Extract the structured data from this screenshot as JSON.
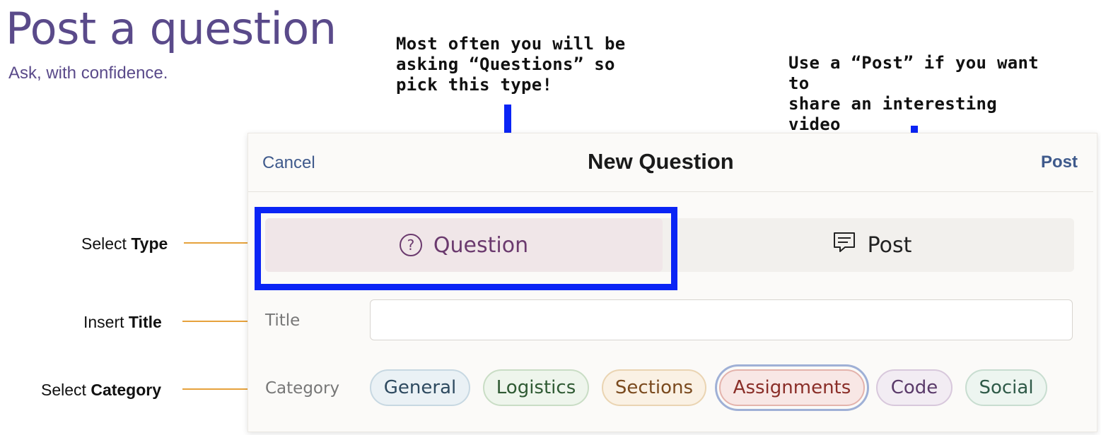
{
  "page": {
    "title": "Post a question",
    "subtitle": "Ask, with confidence."
  },
  "annotations": {
    "question_note": "Most often you will be\nasking “Questions” so\npick this type!",
    "post_note": "Use a “Post” if you want to\nshare an interesting video\nor link (or a TikTok)",
    "arrow_color": "#0a24f5",
    "highlight_color": "#0a24f5",
    "leader_color": "#e6a23c",
    "select_type": {
      "prefix": "Select ",
      "bold": "Type"
    },
    "insert_title": {
      "prefix": "Insert ",
      "bold": "Title"
    },
    "select_category": {
      "prefix": "Select ",
      "bold": "Category"
    }
  },
  "dialog": {
    "cancel_label": "Cancel",
    "title": "New Question",
    "post_label": "Post",
    "type_options": [
      {
        "label": "Question",
        "icon": "question-circle-icon",
        "selected": true
      },
      {
        "label": "Post",
        "icon": "comment-icon",
        "selected": false
      }
    ],
    "title_field": {
      "label": "Title",
      "value": "",
      "placeholder": ""
    },
    "category_label": "Category",
    "categories": [
      {
        "label": "General",
        "bg": "#eaf1f5",
        "border": "#c7d8e2",
        "color": "#2e4a60"
      },
      {
        "label": "Logistics",
        "bg": "#eef5ec",
        "border": "#c9ddc5",
        "color": "#2f5a33"
      },
      {
        "label": "Sections",
        "bg": "#faf1e4",
        "border": "#ead4b2",
        "color": "#7a4a1e"
      },
      {
        "label": "Assignments",
        "bg": "#f8e7e5",
        "border": "#e4b3ac",
        "color": "#8a2e28",
        "selected": true
      },
      {
        "label": "Code",
        "bg": "#f2ecf3",
        "border": "#d8c8dc",
        "color": "#5a3a6a"
      },
      {
        "label": "Social",
        "bg": "#edf5f0",
        "border": "#c8ddd0",
        "color": "#2f5a48"
      }
    ]
  }
}
